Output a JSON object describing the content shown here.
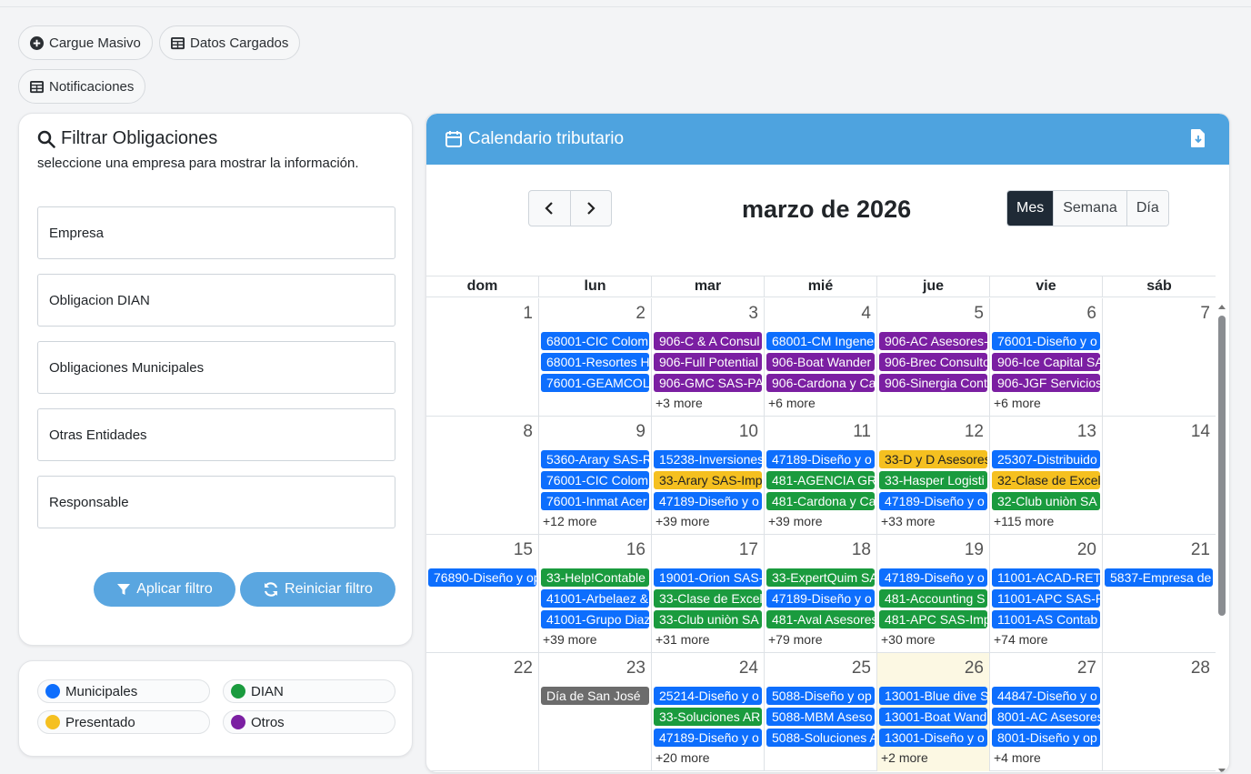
{
  "toolbar": {
    "cargue_label": "Cargue Masivo",
    "datos_label": "Datos Cargados",
    "notif_label": "Notificaciones"
  },
  "filter": {
    "title": "Filtrar Obligaciones",
    "subtitle": "seleccione una empresa para mostrar la información.",
    "fields": [
      "Empresa",
      "Obligacion DIAN",
      "Obligaciones Municipales",
      "Otras Entidades",
      "Responsable"
    ],
    "apply_label": "Aplicar filtro",
    "reset_label": "Reiniciar filtro"
  },
  "legend": [
    {
      "label": "Municipales",
      "color": "#0d6efd"
    },
    {
      "label": "DIAN",
      "color": "#1a9b3e"
    },
    {
      "label": "Presentado",
      "color": "#f5c020"
    },
    {
      "label": "Otros",
      "color": "#7b1fa2"
    }
  ],
  "calendar": {
    "header_title": "Calendario tributario",
    "title": "marzo de 2026",
    "views": [
      "Mes",
      "Semana",
      "Día"
    ],
    "active_view": "Mes",
    "weekdays": [
      "dom",
      "lun",
      "mar",
      "mié",
      "jue",
      "vie",
      "sáb"
    ],
    "colors": {
      "accent": "#4ea3df",
      "blue": "#0d6efd",
      "purple": "#7b1fa2",
      "green": "#1a9b3e",
      "yellow": "#f5c020",
      "gray": "#6c6c6c"
    },
    "weeks": [
      {
        "days": [
          {
            "num": "1",
            "events": [],
            "more": ""
          },
          {
            "num": "2",
            "events": [
              {
                "t": "68001-CIC Colom",
                "c": "blue"
              },
              {
                "t": "68001-Resortes H",
                "c": "blue"
              },
              {
                "t": "76001-GEAMCOL",
                "c": "blue"
              }
            ],
            "more": ""
          },
          {
            "num": "3",
            "events": [
              {
                "t": "906-C & A Consul",
                "c": "purple"
              },
              {
                "t": "906-Full Potential",
                "c": "purple"
              },
              {
                "t": "906-GMC SAS-PA",
                "c": "purple"
              }
            ],
            "more": "+3 more"
          },
          {
            "num": "4",
            "events": [
              {
                "t": "68001-CM Ingene",
                "c": "blue"
              },
              {
                "t": "906-Boat Wander",
                "c": "purple"
              },
              {
                "t": "906-Cardona y Ca",
                "c": "purple"
              }
            ],
            "more": "+6 more"
          },
          {
            "num": "5",
            "events": [
              {
                "t": "906-AC Asesores-",
                "c": "purple"
              },
              {
                "t": "906-Brec Consulto",
                "c": "purple"
              },
              {
                "t": "906-Sinergia Cont",
                "c": "purple"
              }
            ],
            "more": ""
          },
          {
            "num": "6",
            "events": [
              {
                "t": "76001-Diseño y o",
                "c": "blue"
              },
              {
                "t": "906-Ice Capital SA",
                "c": "purple"
              },
              {
                "t": "906-JGF Servicios",
                "c": "purple"
              }
            ],
            "more": "+6 more"
          },
          {
            "num": "7",
            "events": [],
            "more": ""
          }
        ]
      },
      {
        "days": [
          {
            "num": "8",
            "events": [],
            "more": ""
          },
          {
            "num": "9",
            "events": [
              {
                "t": "5360-Arary SAS-R",
                "c": "blue"
              },
              {
                "t": "76001-CIC Colom",
                "c": "blue"
              },
              {
                "t": "76001-Inmat Acer",
                "c": "blue"
              }
            ],
            "more": "+12 more"
          },
          {
            "num": "10",
            "events": [
              {
                "t": "15238-Inversiones",
                "c": "blue"
              },
              {
                "t": "33-Arary SAS-Imp",
                "c": "yellow"
              },
              {
                "t": "47189-Diseño y o",
                "c": "blue"
              }
            ],
            "more": "+39 more"
          },
          {
            "num": "11",
            "events": [
              {
                "t": "47189-Diseño y o",
                "c": "blue"
              },
              {
                "t": "481-AGENCIA GR",
                "c": "green"
              },
              {
                "t": "481-Cardona y Ca",
                "c": "green"
              }
            ],
            "more": "+39 more"
          },
          {
            "num": "12",
            "events": [
              {
                "t": "33-D y D Asesores",
                "c": "yellow"
              },
              {
                "t": "33-Hasper Logisti",
                "c": "green"
              },
              {
                "t": "47189-Diseño y o",
                "c": "blue"
              }
            ],
            "more": "+33 more"
          },
          {
            "num": "13",
            "events": [
              {
                "t": "25307-Distribuido",
                "c": "blue"
              },
              {
                "t": "32-Clase de Excel",
                "c": "yellow"
              },
              {
                "t": "32-Club uniòn SA",
                "c": "green"
              }
            ],
            "more": "+115 more"
          },
          {
            "num": "14",
            "events": [],
            "more": ""
          }
        ]
      },
      {
        "days": [
          {
            "num": "15",
            "events": [
              {
                "t": "76890-Diseño y op",
                "c": "blue"
              }
            ],
            "more": ""
          },
          {
            "num": "16",
            "events": [
              {
                "t": "33-Help!Contable",
                "c": "green"
              },
              {
                "t": "41001-Arbelaez &",
                "c": "blue"
              },
              {
                "t": "41001-Grupo Diaz",
                "c": "blue"
              }
            ],
            "more": "+39 more"
          },
          {
            "num": "17",
            "events": [
              {
                "t": "19001-Orion SAS-",
                "c": "blue"
              },
              {
                "t": "33-Clase de Excel",
                "c": "green"
              },
              {
                "t": "33-Club uniòn SA",
                "c": "green"
              }
            ],
            "more": "+31 more"
          },
          {
            "num": "18",
            "events": [
              {
                "t": "33-ExpertQuim SA",
                "c": "green"
              },
              {
                "t": "47189-Diseño y o",
                "c": "blue"
              },
              {
                "t": "481-Aval Asesores",
                "c": "green"
              }
            ],
            "more": "+79 more"
          },
          {
            "num": "19",
            "events": [
              {
                "t": "47189-Diseño y o",
                "c": "blue"
              },
              {
                "t": "481-Accounting S",
                "c": "green"
              },
              {
                "t": "481-APC SAS-Imp",
                "c": "green"
              }
            ],
            "more": "+30 more"
          },
          {
            "num": "20",
            "events": [
              {
                "t": "11001-ACAD-RETI",
                "c": "blue"
              },
              {
                "t": "11001-APC SAS-R",
                "c": "blue"
              },
              {
                "t": "11001-AS Contab",
                "c": "blue"
              }
            ],
            "more": "+74 more"
          },
          {
            "num": "21",
            "events": [
              {
                "t": "5837-Empresa de",
                "c": "blue"
              }
            ],
            "more": ""
          }
        ]
      },
      {
        "days": [
          {
            "num": "22",
            "events": [],
            "more": ""
          },
          {
            "num": "23",
            "events": [
              {
                "t": "Día de San José",
                "c": "gray"
              }
            ],
            "more": ""
          },
          {
            "num": "24",
            "events": [
              {
                "t": "25214-Diseño y o",
                "c": "blue"
              },
              {
                "t": "33-Soluciones AR",
                "c": "green"
              },
              {
                "t": "47189-Diseño y o",
                "c": "blue"
              }
            ],
            "more": "+20 more"
          },
          {
            "num": "25",
            "events": [
              {
                "t": "5088-Diseño y op",
                "c": "blue"
              },
              {
                "t": "5088-MBM Aseso",
                "c": "blue"
              },
              {
                "t": "5088-Soluciones A",
                "c": "blue"
              }
            ],
            "more": ""
          },
          {
            "num": "26",
            "events": [
              {
                "t": "13001-Blue dive S",
                "c": "blue"
              },
              {
                "t": "13001-Boat Wand",
                "c": "blue"
              },
              {
                "t": "13001-Diseño y o",
                "c": "blue"
              }
            ],
            "more": "+2 more",
            "today": true
          },
          {
            "num": "27",
            "events": [
              {
                "t": "44847-Diseño y o",
                "c": "blue"
              },
              {
                "t": "8001-AC Asesores",
                "c": "blue"
              },
              {
                "t": "8001-Diseño y op",
                "c": "blue"
              }
            ],
            "more": "+4 more"
          },
          {
            "num": "28",
            "events": [],
            "more": ""
          }
        ]
      }
    ]
  }
}
